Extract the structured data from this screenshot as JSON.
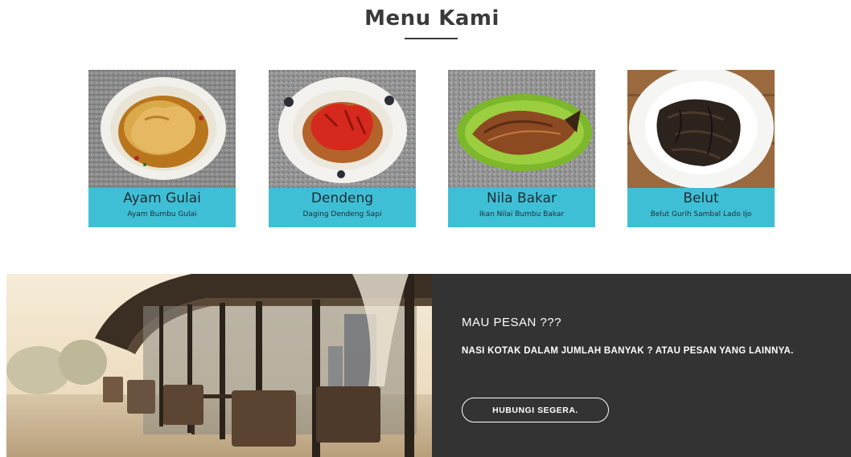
{
  "menu": {
    "title": "Menu Kami",
    "items": [
      {
        "name": "Ayam Gulai",
        "description": "Ayam Bumbu Gulai",
        "image": "ayam-gulai-photo"
      },
      {
        "name": "Dendeng",
        "description": "Daging Dendeng Sapi",
        "image": "dendeng-photo"
      },
      {
        "name": "Nila Bakar",
        "description": "Ikan Nilai Bumbu Bakar",
        "image": "nila-bakar-photo"
      },
      {
        "name": "Belut",
        "description": "Belut Gurih Sambal Lado Ijo",
        "image": "belut-photo"
      }
    ]
  },
  "order": {
    "heading": "MAU PESAN ???",
    "text": "NASI KOTAK DALAM JUMLAH BANYAK ? ATAU PESAN YANG LAINNYA.",
    "button_label": "HUBUNGI SEGERA.",
    "image": "restaurant-terrace-photo"
  },
  "colors": {
    "card_bg": "#3fbfd6",
    "panel_bg": "#333333",
    "title_text": "#3a3a3a"
  }
}
